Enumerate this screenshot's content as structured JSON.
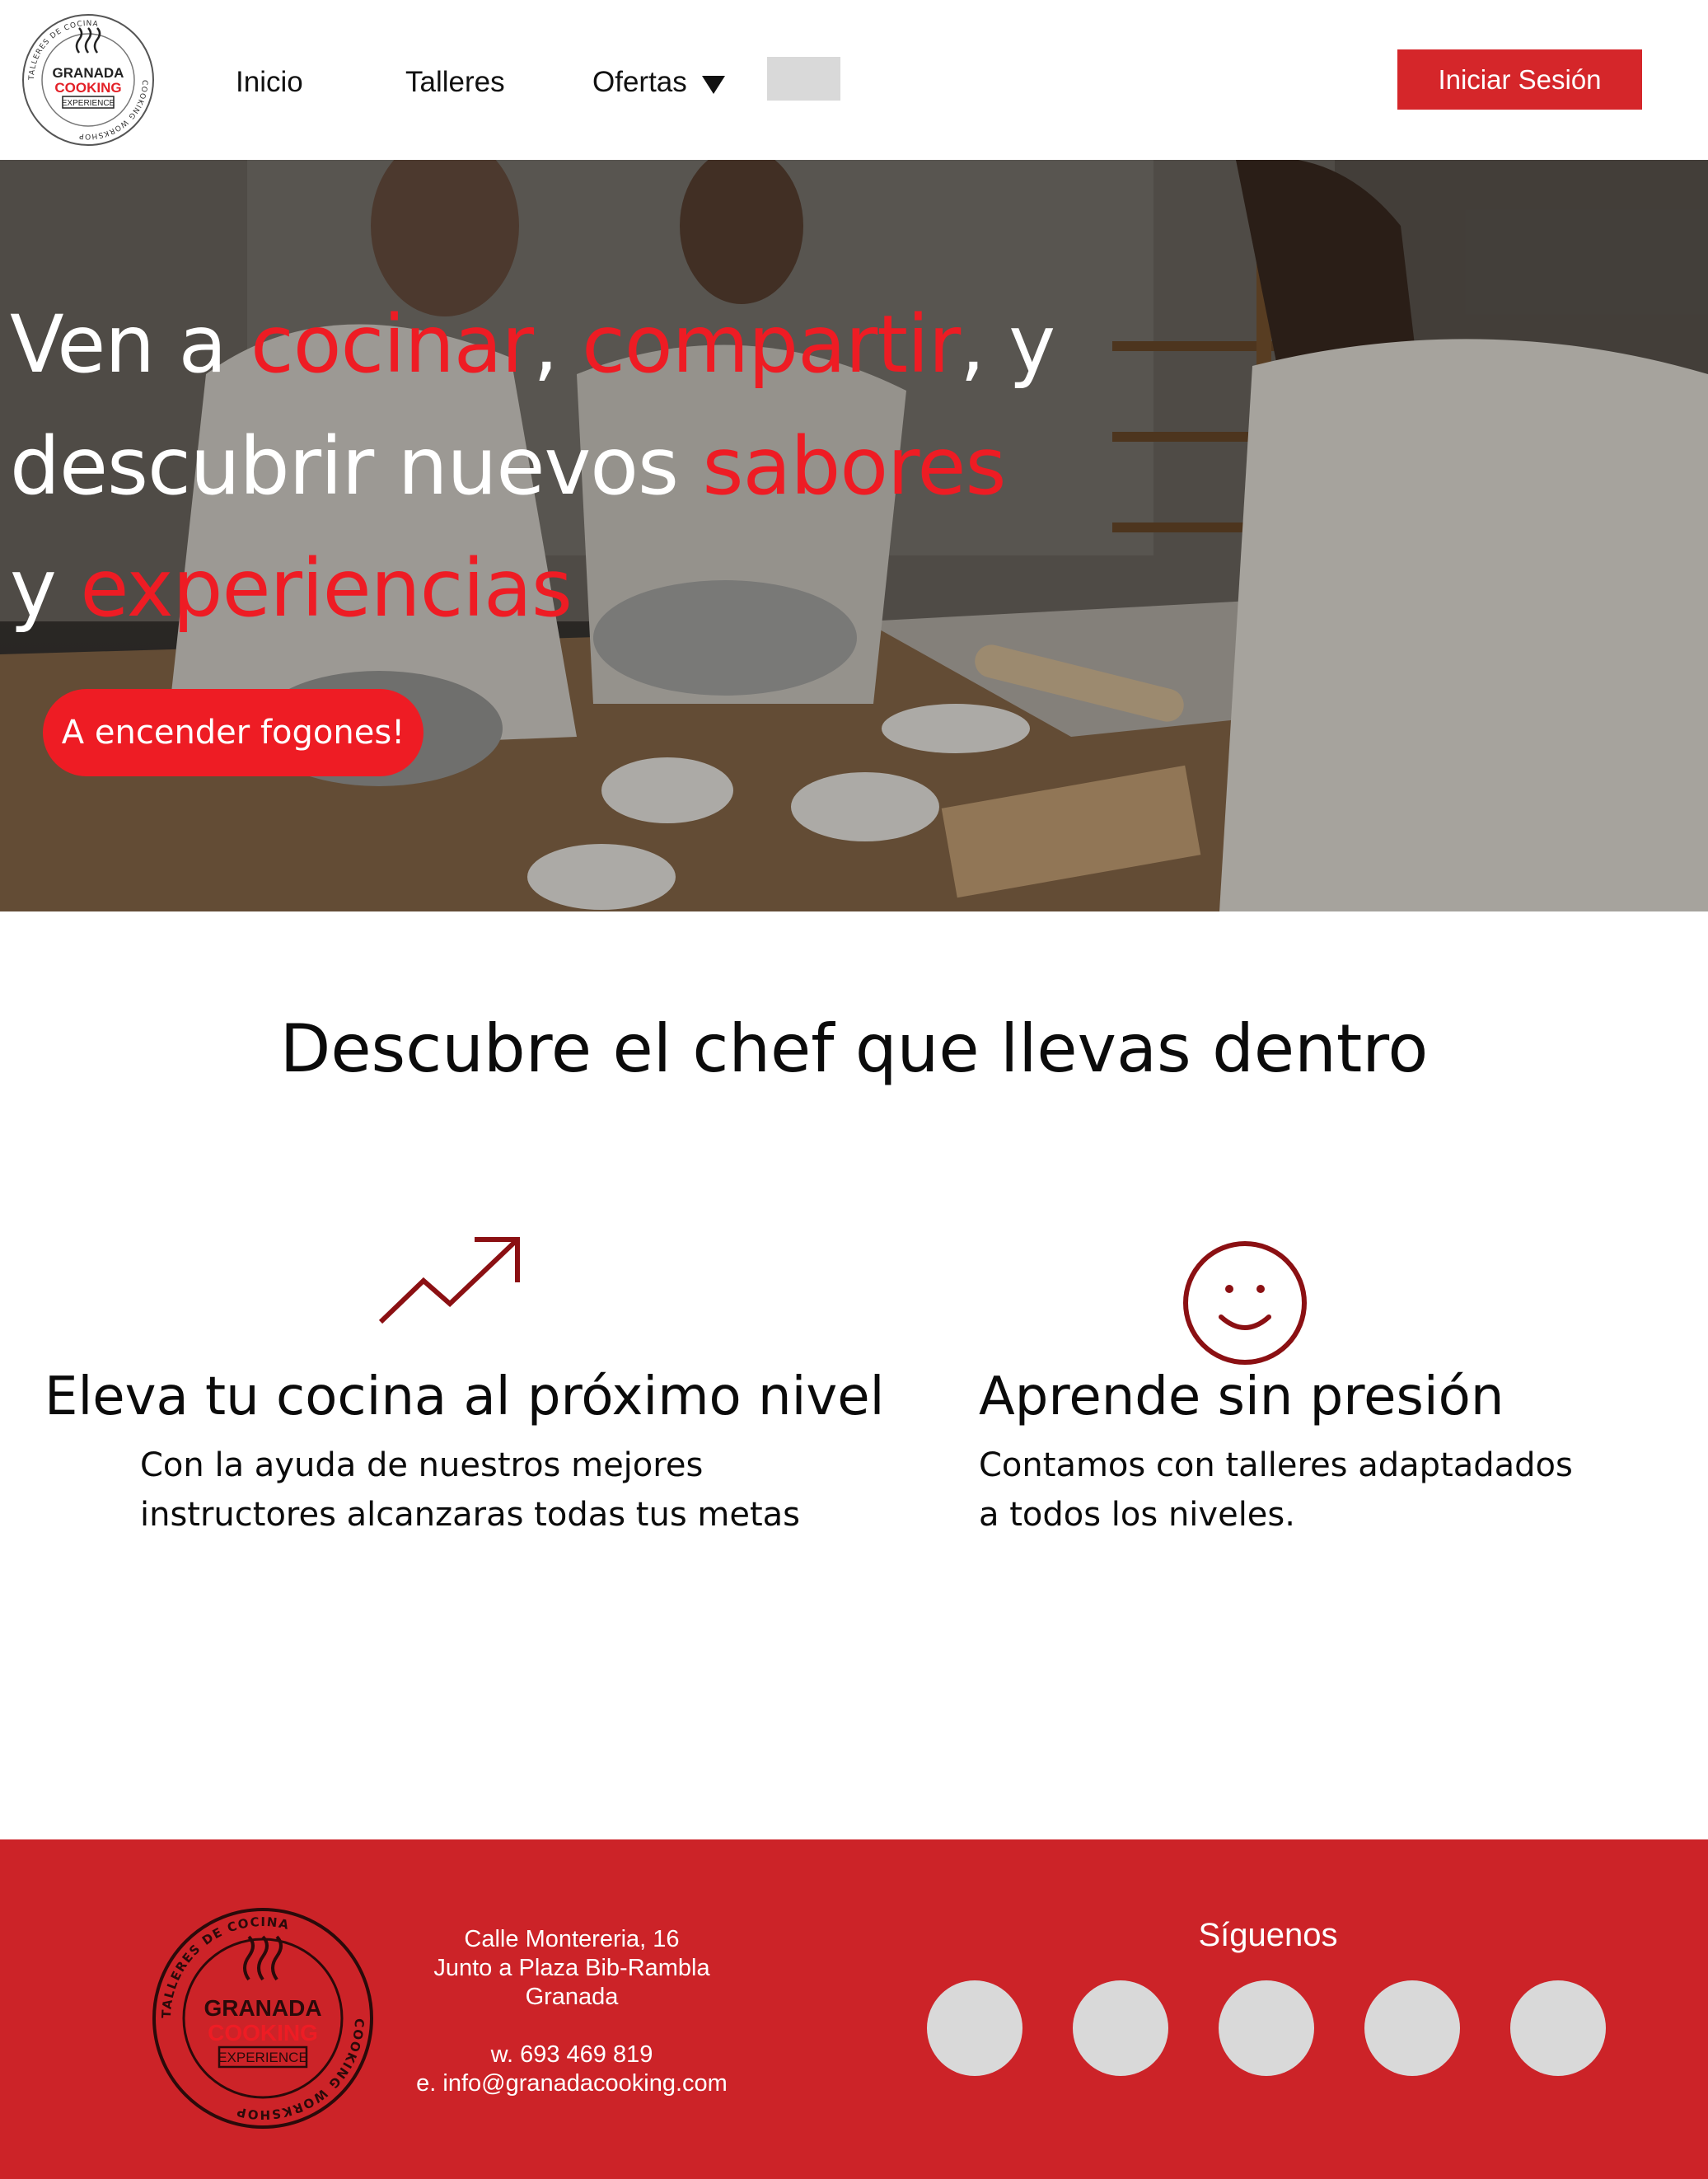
{
  "header": {
    "logo": {
      "top_text": "TALLERES DE COCINA",
      "side_text": "COOKING WORKSHOP",
      "line1": "GRANADA",
      "line2": "COOKING",
      "line3": "EXPERIENCE"
    },
    "nav": [
      "Inicio",
      "Talleres",
      "Ofertas"
    ],
    "login_label": "Iniciar Sesión"
  },
  "hero": {
    "title_parts": {
      "p1": "Ven a ",
      "h1": "cocinar",
      "p2": ", ",
      "h2": "compartir",
      "p3": ", y",
      "p4": "descubrir nuevos ",
      "h3": "sabores",
      "p5": "y ",
      "h4": "experiencias"
    },
    "cta_label": "A encender fogones!"
  },
  "features": {
    "title": "Descubre el chef que llevas dentro",
    "items": [
      {
        "icon": "trending-up-icon",
        "title": "Eleva tu cocina al próximo nivel",
        "desc_lines": [
          "Con  la ayuda de nuestros mejores",
          "instructores alcanzaras todas tus metas"
        ]
      },
      {
        "icon": "smile-icon",
        "title": "Aprende sin presión",
        "desc_lines": [
          "Contamos con talleres adaptadados",
          "a todos los niveles."
        ]
      }
    ]
  },
  "footer": {
    "address": [
      "Calle Montereria, 16",
      "Junto a Plaza Bib-Rambla",
      "Granada"
    ],
    "phone": "w. 693 469 819",
    "email": "e. info@granadacooking.com",
    "follow_title": "Síguenos",
    "social_count": 5
  },
  "colors": {
    "brand_red": "#d5262a",
    "accent_red": "#ee1c24",
    "footer_red": "#cc2328",
    "icon_dark_red": "#8b1013",
    "placeholder_gray": "#d9d9d9"
  }
}
